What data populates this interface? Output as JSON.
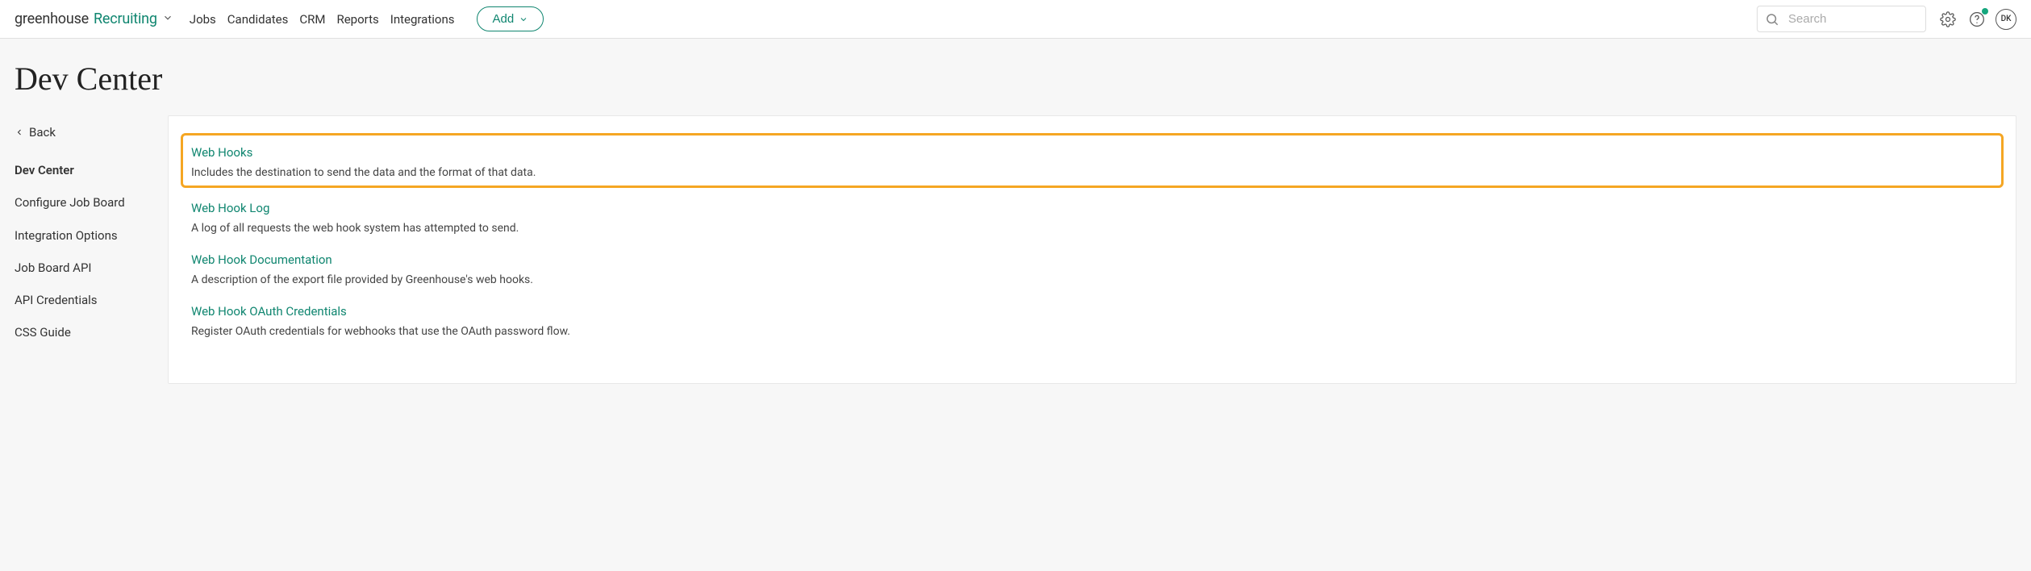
{
  "brand": {
    "part1": "greenhouse",
    "part2": "Recruiting"
  },
  "nav": {
    "items": [
      "Jobs",
      "Candidates",
      "CRM",
      "Reports",
      "Integrations"
    ],
    "add_label": "Add"
  },
  "search": {
    "placeholder": "Search"
  },
  "avatar_initials": "DK",
  "page_title": "Dev Center",
  "sidebar": {
    "back_label": "Back",
    "items": [
      {
        "label": "Dev Center",
        "active": true
      },
      {
        "label": "Configure Job Board",
        "active": false
      },
      {
        "label": "Integration Options",
        "active": false
      },
      {
        "label": "Job Board API",
        "active": false
      },
      {
        "label": "API Credentials",
        "active": false
      },
      {
        "label": "CSS Guide",
        "active": false
      }
    ]
  },
  "entries": [
    {
      "title": "Web Hooks",
      "desc": "Includes the destination to send the data and the format of that data.",
      "highlighted": true
    },
    {
      "title": "Web Hook Log",
      "desc": "A log of all requests the web hook system has attempted to send.",
      "highlighted": false
    },
    {
      "title": "Web Hook Documentation",
      "desc": "A description of the export file provided by Greenhouse's web hooks.",
      "highlighted": false
    },
    {
      "title": "Web Hook OAuth Credentials",
      "desc": "Register OAuth credentials for webhooks that use the OAuth password flow.",
      "highlighted": false
    }
  ]
}
